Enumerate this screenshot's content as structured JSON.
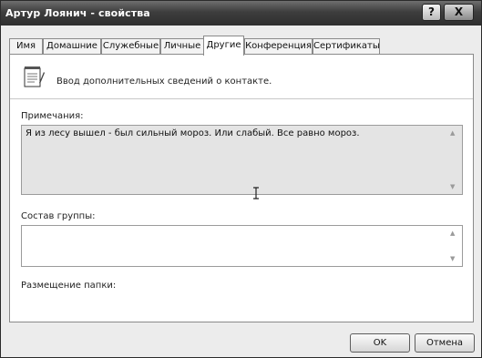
{
  "window": {
    "title": "Артур Лоянич - свойства"
  },
  "titlebar": {
    "help_label": "?",
    "close_label": "X"
  },
  "tabs": [
    {
      "label": "Имя",
      "active": false
    },
    {
      "label": "Домашние",
      "active": false
    },
    {
      "label": "Служебные",
      "active": false
    },
    {
      "label": "Личные",
      "active": false
    },
    {
      "label": "Другие",
      "active": true
    },
    {
      "label": "Конференция",
      "active": false
    },
    {
      "label": "Сертификаты",
      "active": false
    }
  ],
  "other_tab": {
    "intro_text": "Ввод  дополнительных сведений о контакте.",
    "notes_label": "Примечания:",
    "notes_value": "Я из лесу вышел - был сильный мороз. Или слабый. Все равно мороз.",
    "group_label": "Состав группы:",
    "group_value": "",
    "folder_label": "Размещение папки:"
  },
  "buttons": {
    "ok": "OK",
    "cancel": "Отмена"
  },
  "icons": [
    "notepad-icon",
    "scroll-up-arrow-icon",
    "scroll-down-arrow-icon",
    "text-cursor-icon",
    "help-icon",
    "close-icon"
  ]
}
